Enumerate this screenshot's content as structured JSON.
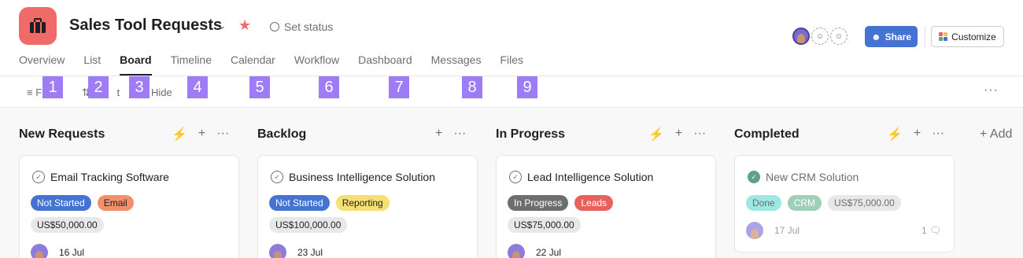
{
  "project": {
    "title": "Sales Tool Requests",
    "set_status": "Set status",
    "icon": "briefcase-icon",
    "icon_color": "#f06a6a"
  },
  "tabs": [
    "Overview",
    "List",
    "Board",
    "Timeline",
    "Calendar",
    "Workflow",
    "Dashboard",
    "Messages",
    "Files"
  ],
  "active_tab": "Board",
  "header_actions": {
    "share_label": "Share",
    "customize_label": "Customize",
    "share_color": "#4573d2"
  },
  "toolbar": {
    "filter_label": "F",
    "sort_label": "t",
    "hide_label": "Hide"
  },
  "badges": [
    "1",
    "2",
    "3",
    "4",
    "5",
    "6",
    "7",
    "8",
    "9"
  ],
  "add_section_label": "+ Add",
  "columns": [
    {
      "name": "New Requests",
      "card": {
        "title": "Email Tracking Software",
        "status": "Not Started",
        "status_color": "#4573d2",
        "category": "Email",
        "category_color": "#f1906b",
        "price": "US$50,000.00",
        "date": "16 Jul"
      }
    },
    {
      "name": "Backlog",
      "card": {
        "title": "Business Intelligence Solution",
        "status": "Not Started",
        "status_color": "#4573d2",
        "category": "Reporting",
        "category_color": "#f8df72",
        "price": "US$100,000.00",
        "date": "23 Jul"
      }
    },
    {
      "name": "In Progress",
      "card": {
        "title": "Lead Intelligence Solution",
        "status": "In Progress",
        "status_color": "#6d6e6f",
        "category": "Leads",
        "category_color": "#e8615d",
        "price": "US$75,000.00",
        "date": "22 Jul"
      }
    },
    {
      "name": "Completed",
      "card": {
        "title": "New CRM Solution",
        "status": "Done",
        "status_color": "#9ee7e3",
        "category": "CRM",
        "category_color": "#9fcfb7",
        "price": "US$75,000.00",
        "date": "17 Jul",
        "comments": "1"
      }
    }
  ]
}
